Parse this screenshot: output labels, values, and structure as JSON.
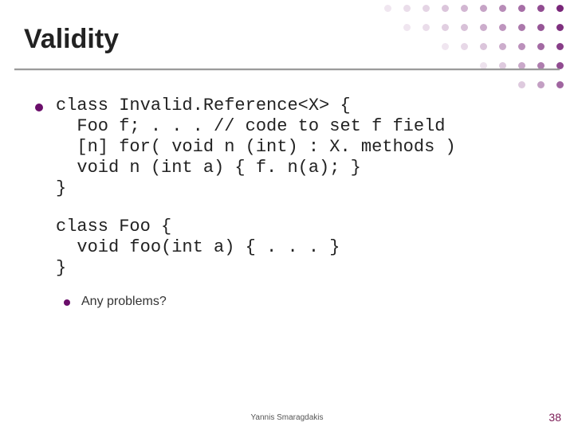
{
  "slide": {
    "title": "Validity",
    "code1": "class Invalid.Reference<X> {\n  Foo f; . . . // code to set f field\n  [n] for( void n (int) : X. methods )\n  void n (int a) { f. n(a); }\n}",
    "code2": "class Foo {\n  void foo(int a) { . . . }\n}",
    "sub_bullet": "Any problems?",
    "footer_author": "Yannis Smaragdakis",
    "page_number": "38"
  },
  "colors": {
    "accent": "#6a0e6a",
    "title": "#222222",
    "page_number": "#7a1a55"
  }
}
